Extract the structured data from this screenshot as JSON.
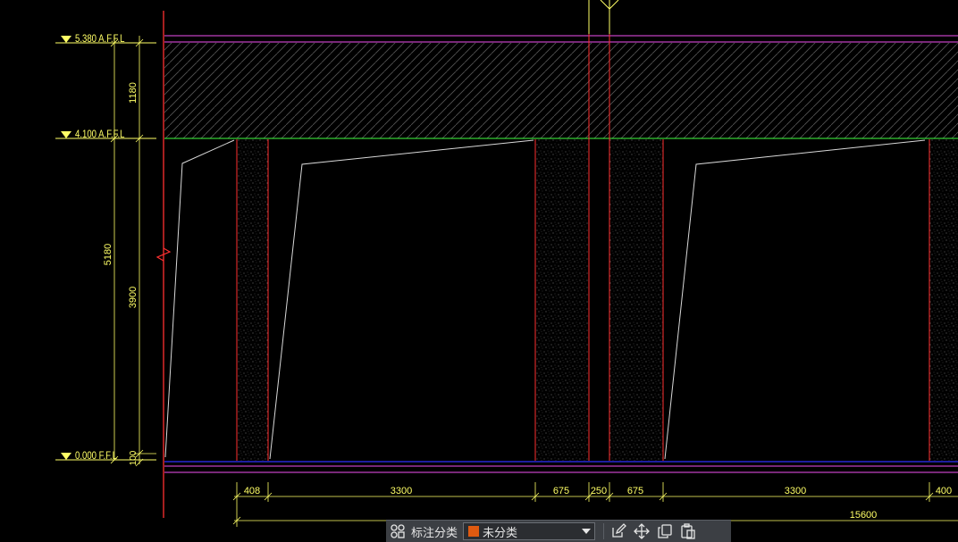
{
  "drawing": {
    "colors": {
      "background": "#000000",
      "red": "#ff3030",
      "yellow": "#ffff66",
      "magenta": "#c040c0",
      "blue": "#3030ff",
      "green": "#40ff40",
      "white": "#d8d8d8"
    },
    "levels": [
      {
        "label": "5.380 A.F.F.L"
      },
      {
        "label": "4.100 A.F.F.L"
      },
      {
        "label": "0.000 F.F.L"
      }
    ],
    "vertical_dims": {
      "d1180": "1180",
      "d5180": "5180",
      "d3900": "3900",
      "d100": "100"
    },
    "horizontal_dims": {
      "d408": "408",
      "d3300a": "3300",
      "d675a": "675",
      "d250": "250",
      "d675b": "675",
      "d3300b": "3300",
      "d400": "400",
      "total": "15600"
    }
  },
  "toolbar": {
    "classify_label": "标注分类",
    "dropdown_value": "未分类",
    "swatch_color": "#e05a10",
    "icons": [
      "grid-icon",
      "edit-icon",
      "move-icon",
      "copy-icon",
      "paste-icon"
    ]
  }
}
